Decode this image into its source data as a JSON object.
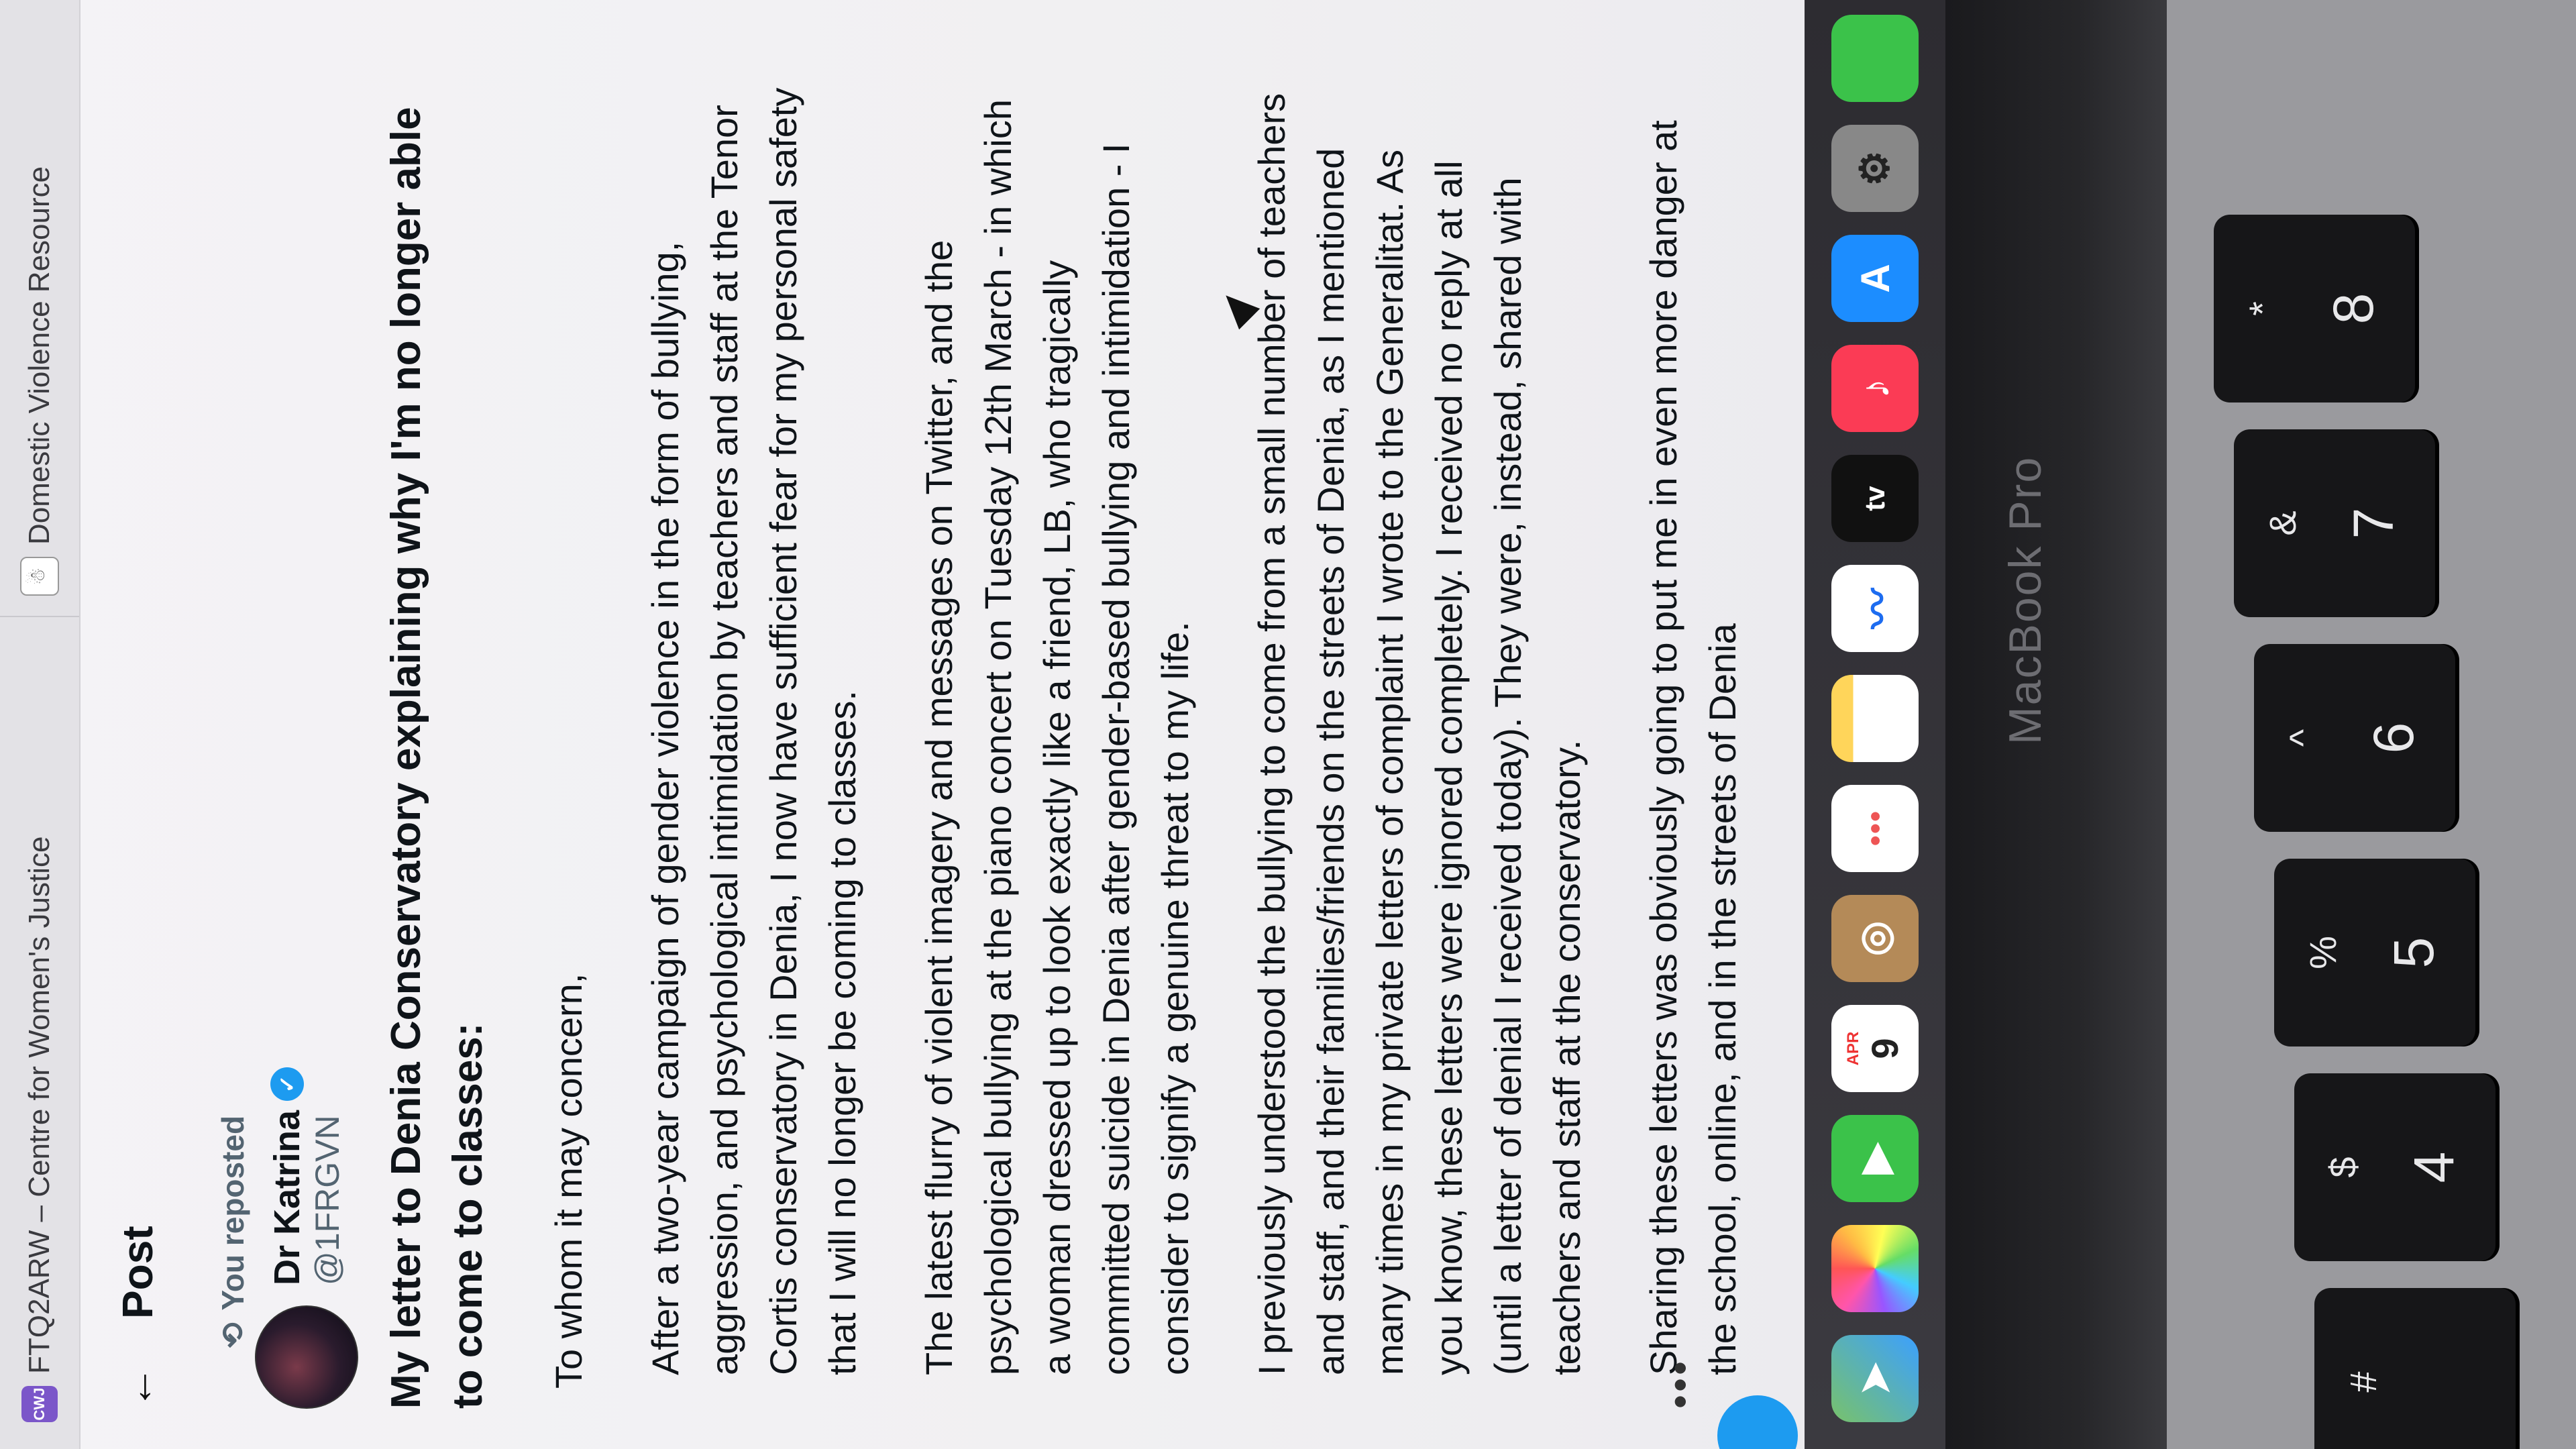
{
  "browser": {
    "tab1_title": "FTQ2ARW – Centre for Women's Justice",
    "tab1_icon": "cwj-logo",
    "tab2_title": "Domestic Violence Resource",
    "tab2_icon": "dv-resource-icon"
  },
  "post": {
    "header_title": "Post",
    "repost_text": "You reposted",
    "author_name": "Dr Katrina",
    "author_handle": "@1FRGVN",
    "headline": "My letter to Denia Conservatory explaining why I'm no longer able to come to classes:",
    "salutation": "To whom it may concern,",
    "paragraph1": "After a two-year campaign of gender violence in the form of bullying, aggression, and psychological intimidation by teachers and staff at the Tenor Cortis conservatory in Denia, I now have sufficient fear for my personal safety that I will no longer be coming to classes.",
    "paragraph2": "The latest flurry of violent imagery and messages on Twitter, and the psychological bullying at the piano concert on Tuesday 12th March - in which a woman dressed up to look exactly like a friend, LB, who tragically committed suicide in Denia after gender-based bullying and intimidation - I consider to signify a genuine threat to my life.",
    "paragraph3": "I previously understood the bullying to come from a small number of teachers and staff, and their families/friends on the streets of Denia, as I mentioned many times in my private letters of complaint I wrote to the Generalitat. As you know, these letters were ignored completely. I received no reply at all (until a letter of denial I received today). They were, instead, shared with teachers and staff at the conservatory.",
    "paragraph4": "Sharing these letters was obviously going to put me in even more danger at the school, online, and in the streets of Denia",
    "more": "•••"
  },
  "dock": {
    "calendar_month": "APR",
    "calendar_day": "9",
    "tv_label": "tv",
    "apps": [
      "maps-icon",
      "photos-icon",
      "facetime-icon",
      "calendar-icon",
      "contacts-icon",
      "reminders-icon",
      "notes-icon",
      "freeform-icon",
      "tv-icon",
      "music-icon",
      "appstore-icon",
      "settings-icon"
    ]
  },
  "hardware": {
    "model_label": "MacBook Pro",
    "keys": [
      {
        "upper": "#",
        "lower": ""
      },
      {
        "upper": "$",
        "lower": "4"
      },
      {
        "upper": "%",
        "lower": "5"
      },
      {
        "upper": "^",
        "lower": "6"
      },
      {
        "upper": "&",
        "lower": "7"
      },
      {
        "upper": "*",
        "lower": "8"
      }
    ]
  }
}
